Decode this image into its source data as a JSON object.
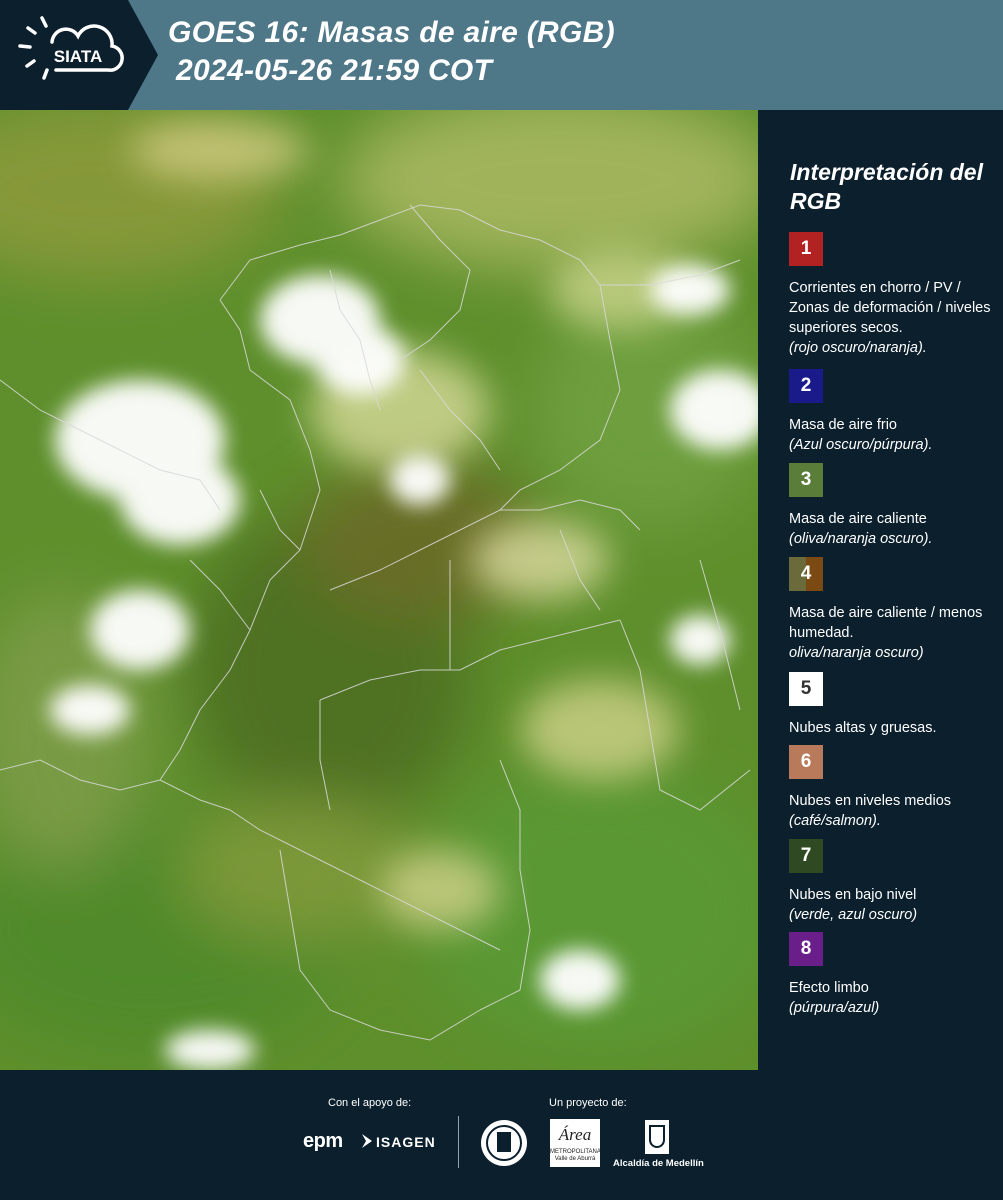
{
  "header": {
    "logo_text": "SIATA",
    "title_line1": "GOES 16: Masas de aire (RGB)",
    "title_line2": "2024-05-26 21:59 COT"
  },
  "legend": {
    "title": "Interpretación del RGB",
    "items": [
      {
        "number": "1",
        "color": "#b22222",
        "text": "Corrientes en chorro / PV / Zonas de deformación / niveles superiores secos.",
        "note": "(rojo oscuro/naranja)."
      },
      {
        "number": "2",
        "color": "#1a1a8a",
        "text": "Masa de aire frio",
        "note": "(Azul oscuro/púrpura)."
      },
      {
        "number": "3",
        "color": "#5a7d3a",
        "text": "Masa de aire caliente",
        "note": "(oliva/naranja oscuro)."
      },
      {
        "number": "4",
        "color": "#6b6a3a",
        "text": "Masa de aire caliente / menos humedad.",
        "note": "oliva/naranja oscuro)"
      },
      {
        "number": "5",
        "color": "#ffffff",
        "text": "Nubes altas y gruesas.",
        "note": ""
      },
      {
        "number": "6",
        "color": "#b87a5a",
        "text": "Nubes en niveles medios",
        "note": "(café/salmon)."
      },
      {
        "number": "7",
        "color": "#2f4a22",
        "text": "Nubes en bajo nivel",
        "note": "(verde, azul oscuro)"
      },
      {
        "number": "8",
        "color": "#6a1e8a",
        "text": "Efecto limbo",
        "note": "(púrpura/azul)"
      }
    ]
  },
  "footer": {
    "support_label": "Con el apoyo de:",
    "project_label": "Un proyecto de:",
    "sponsor1": "epm",
    "sponsor2": "ISAGEN",
    "partner1": "Área",
    "partner1_sub": "METROPOLITANA Valle de Aburrá",
    "partner2": "Alcaldía de Medellín"
  },
  "colors": {
    "header_bg": "#4e7788",
    "panel_bg": "#0b1f2d"
  }
}
